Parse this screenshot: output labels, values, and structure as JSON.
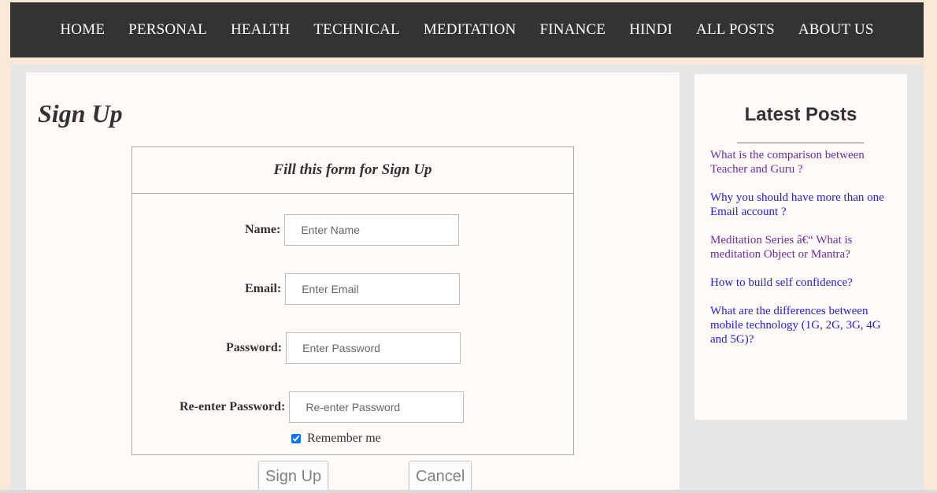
{
  "nav": {
    "items": [
      "HOME",
      "PERSONAL",
      "HEALTH",
      "TECHNICAL",
      "MEDITATION",
      "FINANCE",
      "HINDI",
      "ALL POSTS",
      "ABOUT US"
    ]
  },
  "page": {
    "title": "Sign Up"
  },
  "form": {
    "heading": "Fill this form for Sign Up",
    "name_label": "Name:",
    "name_placeholder": "Enter Name",
    "email_label": "Email:",
    "email_placeholder": "Enter Email",
    "password_label": "Password:",
    "password_placeholder": "Enter Password",
    "reenter_label": "Re-enter Password:",
    "reenter_placeholder": "Re-enter Password",
    "remember_label": "Remember me",
    "remember_checked": true,
    "signup_label": "Sign Up",
    "cancel_label": "Cancel"
  },
  "sidebar": {
    "title": "Latest Posts",
    "posts": [
      {
        "text": "What is the comparison between Teacher and Guru ?",
        "color": "#6b2fa0"
      },
      {
        "text": "Why you should have more than one Email account ?",
        "color": "#2323d6"
      },
      {
        "text": "Meditation Series â€“ What is meditation Object or Mantra?",
        "color": "#6b2fa0"
      },
      {
        "text": "How to build self confidence?",
        "color": "#2323d6"
      },
      {
        "text": "What are the differences between mobile technology (1G, 2G, 3G, 4G and 5G)?",
        "color": "#2323d6"
      }
    ]
  },
  "colors": {
    "nav_bg": "#333333",
    "page_bg": "#fbe9d7",
    "panel_bg": "#fff9f8"
  }
}
